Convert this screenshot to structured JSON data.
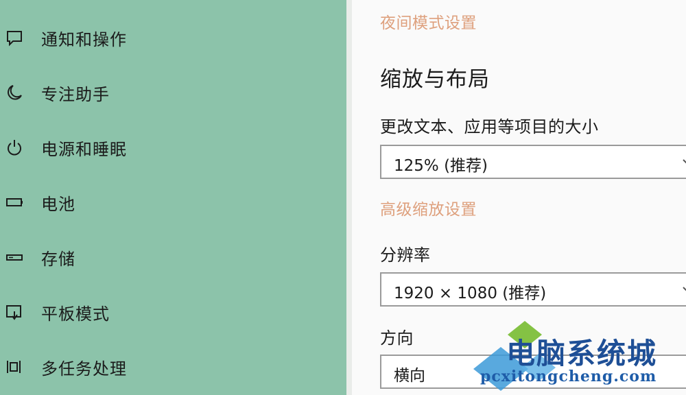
{
  "sidebar": {
    "items": [
      {
        "label": "通知和操作",
        "icon": "message-icon"
      },
      {
        "label": "专注助手",
        "icon": "moon-icon"
      },
      {
        "label": "电源和睡眠",
        "icon": "power-icon"
      },
      {
        "label": "电池",
        "icon": "battery-icon"
      },
      {
        "label": "存储",
        "icon": "storage-icon"
      },
      {
        "label": "平板模式",
        "icon": "tablet-mode-icon"
      },
      {
        "label": "多任务处理",
        "icon": "multitasking-icon"
      }
    ]
  },
  "main": {
    "night_mode_link": "夜间模式设置",
    "section_title": "缩放与布局",
    "scale_label": "更改文本、应用等项目的大小",
    "scale_value": "125% (推荐)",
    "advanced_scale_link": "高级缩放设置",
    "resolution_label": "分辨率",
    "resolution_value": "1920 × 1080 (推荐)",
    "orientation_label": "方向",
    "orientation_value": "横向"
  },
  "watermark": {
    "cn": "电脑系统城",
    "en": "pcxitongcheng.com"
  },
  "colors": {
    "sidebar_bg": "#8cc3aa",
    "link": "#dea07d",
    "watermark_blue": "#1e4f96"
  }
}
